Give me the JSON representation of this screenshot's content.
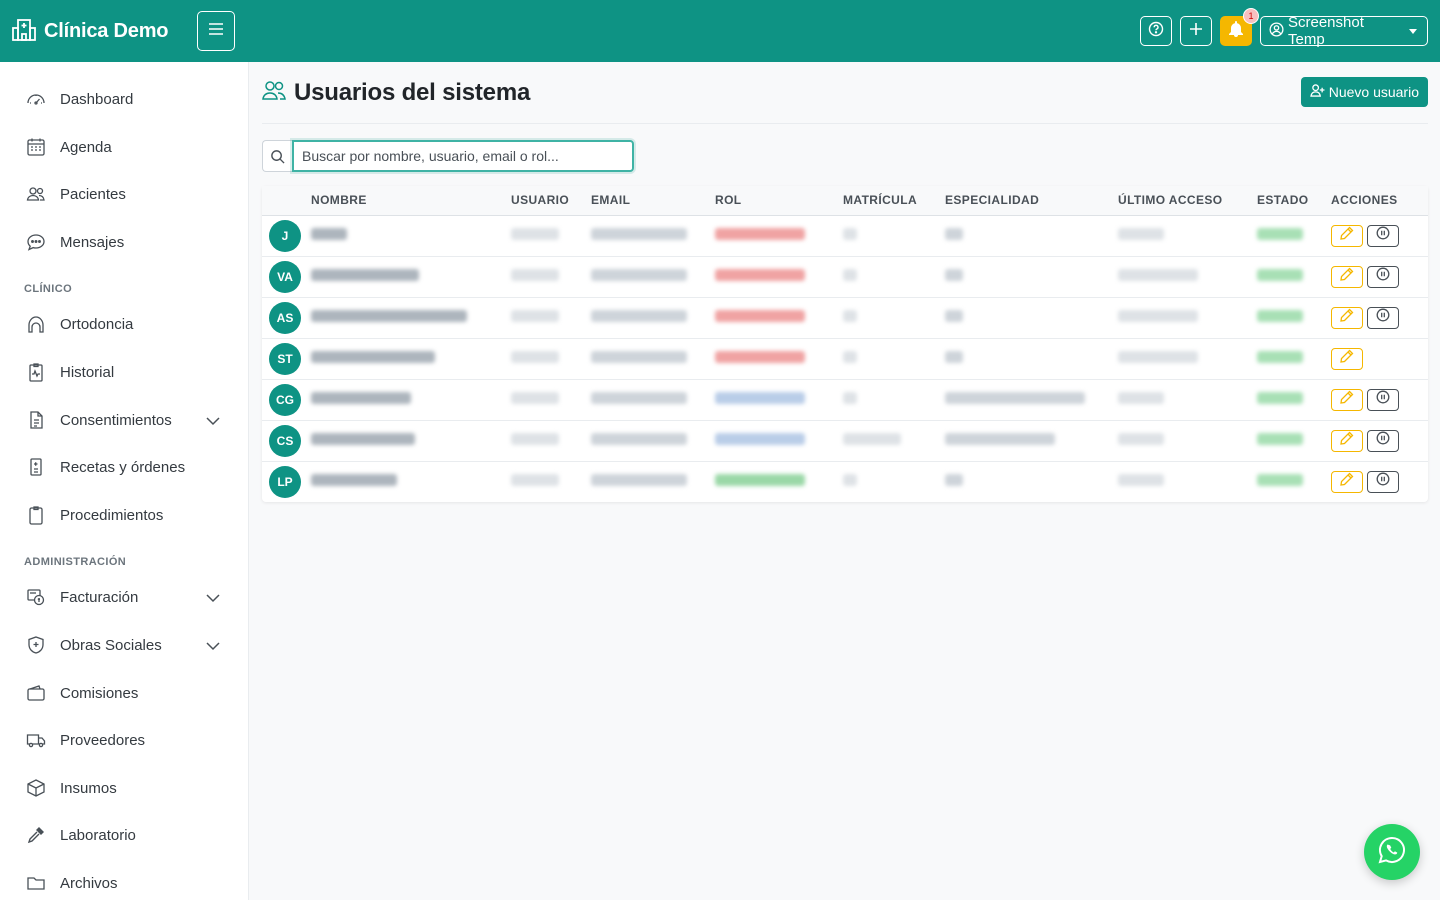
{
  "app": {
    "title": "Clínica Demo"
  },
  "topbar": {
    "notification_count": "1",
    "user_label": "Screenshot Temp"
  },
  "sidebar": {
    "items": [
      {
        "label": "Dashboard",
        "icon": "dashboard-icon"
      },
      {
        "label": "Agenda",
        "icon": "calendar-icon"
      },
      {
        "label": "Pacientes",
        "icon": "people-icon"
      },
      {
        "label": "Mensajes",
        "icon": "chat-icon"
      }
    ],
    "section_clinico": "CLÍNICO",
    "clinico_items": [
      {
        "label": "Ortodoncia",
        "icon": "tooth-icon"
      },
      {
        "label": "Historial",
        "icon": "clipboard-pulse-icon"
      },
      {
        "label": "Consentimientos",
        "icon": "document-icon"
      },
      {
        "label": "Recetas y órdenes",
        "icon": "prescription-icon"
      },
      {
        "label": "Procedimientos",
        "icon": "clipboard-icon"
      }
    ],
    "section_admin": "ADMINISTRACIÓN",
    "admin_items": [
      {
        "label": "Facturación",
        "icon": "invoice-icon"
      },
      {
        "label": "Obras Sociales",
        "icon": "shield-icon"
      },
      {
        "label": "Comisiones",
        "icon": "wallet-icon"
      },
      {
        "label": "Proveedores",
        "icon": "truck-icon"
      },
      {
        "label": "Insumos",
        "icon": "box-icon"
      },
      {
        "label": "Laboratorio",
        "icon": "eyedropper-icon"
      },
      {
        "label": "Archivos",
        "icon": "folder-icon"
      }
    ]
  },
  "main": {
    "title": "Usuarios del sistema",
    "new_button": "Nuevo usuario",
    "search_placeholder": "Buscar por nombre, usuario, email o rol...",
    "columns": [
      "NOMBRE",
      "USUARIO",
      "EMAIL",
      "ROL",
      "MATRÍCULA",
      "ESPECIALIDAD",
      "ÚLTIMO ACCESO",
      "ESTADO",
      "ACCIONES"
    ],
    "rows": [
      {
        "initials": "J",
        "pausable": true
      },
      {
        "initials": "VA",
        "pausable": true
      },
      {
        "initials": "AS",
        "pausable": true
      },
      {
        "initials": "ST",
        "pausable": false
      },
      {
        "initials": "CG",
        "pausable": true
      },
      {
        "initials": "CS",
        "pausable": true
      },
      {
        "initials": "LP",
        "pausable": true
      }
    ]
  },
  "colors": {
    "primary": "#0e9384",
    "warning": "#f5b700",
    "whatsapp": "#25d366"
  }
}
